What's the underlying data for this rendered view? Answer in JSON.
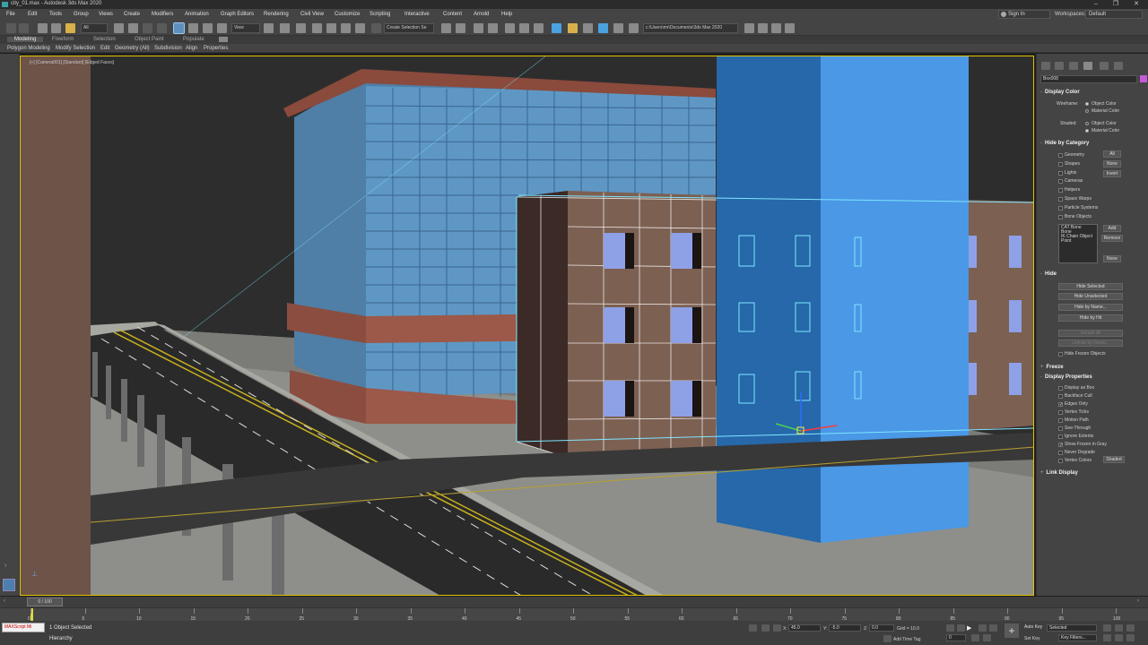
{
  "window": {
    "title": "city_01.max - Autodesk 3ds Max 2020",
    "controls": [
      "–",
      "❐",
      "✕"
    ]
  },
  "menu": {
    "items": [
      "File",
      "Edit",
      "Tools",
      "Group",
      "Views",
      "Create",
      "Modifiers",
      "Animation",
      "Graph Editors",
      "Rendering",
      "Civil View",
      "Customize",
      "Scripting",
      "Interactive",
      "Content",
      "Arnold",
      "Help"
    ],
    "signin": "Sign In",
    "workspaces_label": "Workspaces:",
    "workspace": "Default"
  },
  "toolbar": {
    "selection_filter": "All",
    "ref_coord": "View",
    "named_sel": "Create Selection Se",
    "project_path": "c:\\Users\\mr\\Documents\\3ds Max 2020"
  },
  "ribbon": {
    "tabs": [
      "Modeling",
      "Freeform",
      "Selection",
      "Object Paint",
      "Populate"
    ],
    "subtabs": [
      "Polygon Modeling",
      "Modify Selection",
      "Edit",
      "Geometry (All)",
      "Subdivision",
      "Align",
      "Properties"
    ]
  },
  "viewport": {
    "label": "[+] [Camera001] [Standard] [Edged Faces]"
  },
  "command_panel": {
    "object_name": "Box008",
    "object_color": "#c35bd6",
    "display_color": {
      "title": "Display Color",
      "wireframe_label": "Wireframe:",
      "shaded_label": "Shaded:",
      "opt_object_color": "Object Color",
      "opt_material_color": "Material Color"
    },
    "hide_by_category": {
      "title": "Hide by Category",
      "items": [
        "Geometry",
        "Shapes",
        "Lights",
        "Cameras",
        "Helpers",
        "Space Warps",
        "Particle Systems",
        "Bone Objects"
      ],
      "btn_all": "All",
      "btn_none": "None",
      "btn_invert": "Invert",
      "list": [
        "CAT Bone",
        "Bone",
        "IK Chain Object",
        "Point"
      ],
      "btn_add": "Add",
      "btn_remove": "Remove",
      "btn_none2": "None"
    },
    "hide": {
      "title": "Hide",
      "buttons": [
        "Hide Selected",
        "Hide Unselected",
        "Hide by Name...",
        "Hide by Hit"
      ],
      "disabled_buttons": [
        "Unhide All",
        "Unhide by Name..."
      ],
      "hide_frozen": "Hide Frozen Objects"
    },
    "freeze": {
      "title": "Freeze"
    },
    "display_properties": {
      "title": "Display Properties",
      "items": [
        "Display as Box",
        "Backface Cull",
        "Edges Only",
        "Vertex Ticks",
        "Motion Path",
        "See-Through",
        "Ignore Extents",
        "Show Frozen in Gray",
        "Never Degrade",
        "Vertex Colors"
      ],
      "checked": [
        false,
        false,
        true,
        false,
        false,
        false,
        false,
        true,
        false,
        false
      ],
      "shaded_btn": "Shaded"
    },
    "link_display": {
      "title": "Link Display"
    }
  },
  "timeline": {
    "slider": "0 / 100",
    "ticks": [
      "0",
      "5",
      "10",
      "15",
      "20",
      "25",
      "30",
      "35",
      "40",
      "45",
      "50",
      "55",
      "60",
      "65",
      "70",
      "75",
      "80",
      "85",
      "90",
      "95",
      "100"
    ]
  },
  "status": {
    "maxscript": "MAXScript Mi",
    "message": "1 Object Selected",
    "hierarchy": "Hierarchy",
    "x_label": "X:",
    "x_value": "45.0",
    "y_label": "Y:",
    "y_value": "-5.0",
    "z_label": "Z:",
    "z_value": "0.0",
    "grid": "Grid = 10.0",
    "add_time_tag": "Add Time Tag",
    "auto_key": "Auto Key",
    "selected": "Selected",
    "set_key": "Set Key",
    "key_filters": "Key Filters...",
    "frame": "0"
  }
}
